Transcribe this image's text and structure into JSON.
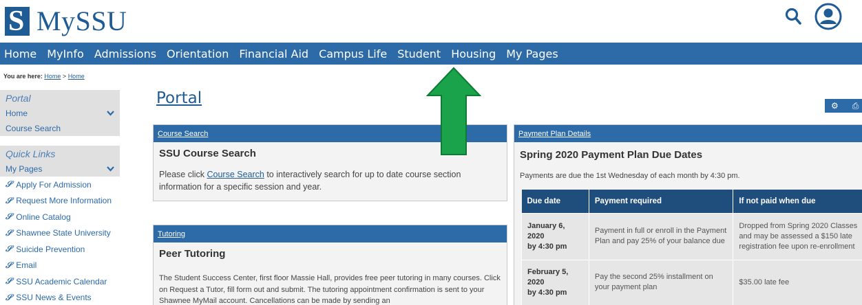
{
  "header": {
    "logo_letter": "S",
    "logo_text": "MySSU",
    "brand_color": "#1f5c96",
    "search_icon": "search-icon",
    "user_icon": "user-account-icon"
  },
  "nav": {
    "items": [
      "Home",
      "MyInfo",
      "Admissions",
      "Orientation",
      "Financial Aid",
      "Campus Life",
      "Student",
      "Housing",
      "My Pages"
    ],
    "background": "#2c6aa8"
  },
  "breadcrumb": {
    "prefix": "You are here:",
    "crumb1": "Home",
    "separator": ">",
    "crumb2": "Home"
  },
  "sidebar": {
    "portal_heading": "Portal",
    "home_label": "Home",
    "course_search_label": "Course Search",
    "quick_links_heading": "Quick Links",
    "my_pages_label": "My Pages",
    "links": [
      "Apply For Admission",
      "Request More Information",
      "Online Catalog",
      "Shawnee State University",
      "Suicide Prevention",
      "Email",
      "SSU Academic Calendar",
      "SSU News & Events"
    ]
  },
  "main": {
    "title": "Portal",
    "course_panel": {
      "header_link": "Course Search",
      "title": "SSU Course Search",
      "text_before": "Please click ",
      "link_text": "Course Search",
      "text_after": " to interactively search for up to date course section information for a specific session and year."
    },
    "tutoring_panel": {
      "header_link": "Tutoring",
      "title": "Peer Tutoring",
      "text": "The Student Success Center, first floor Massie Hall, provides free peer tutoring in many courses. Click on Request a Tutor, fill form out and submit. The tutoring appointment confirmation is sent to your Shawnee MyMail account. Cancellations can be made by sending an"
    },
    "payment_panel": {
      "header_link": "Payment Plan Details",
      "title": "Spring 2020 Payment Plan Due Dates",
      "intro": "Payments are due the 1st Wednesday of each month by 4:30 pm.",
      "columns": [
        "Due date",
        "Payment required",
        "If not paid when due"
      ],
      "rows": [
        {
          "date_line1": "January 6,",
          "date_line2": "2020",
          "date_line3": "by 4:30 pm",
          "required": "Payment in full or enroll in the Payment Plan and pay 25% of your balance due",
          "if_not_paid": "Dropped from Spring 2020 Classes and may be assessed a $150 late registration fee upon re-enrollment"
        },
        {
          "date_line1": "February 5,",
          "date_line2": "2020",
          "date_line3": "by 4:30 pm",
          "required": "Pay the second 25% installment on your payment plan",
          "if_not_paid": "$35.00 late fee"
        }
      ]
    }
  },
  "annotation": {
    "arrow_color": "#1aa34a",
    "arrow_direction": "up"
  }
}
